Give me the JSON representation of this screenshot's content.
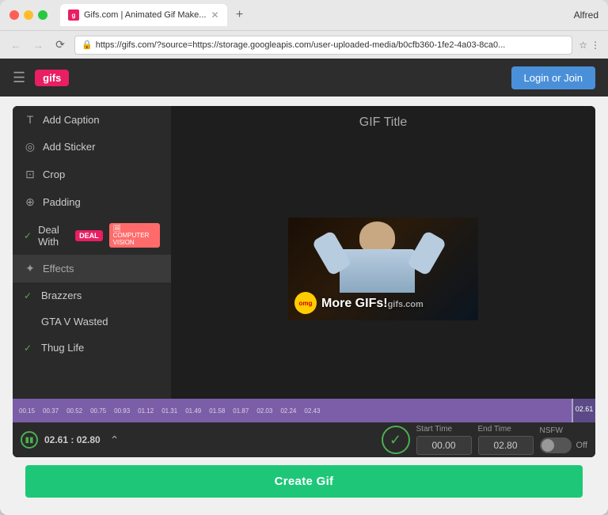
{
  "browser": {
    "tab_title": "Gifs.com | Animated Gif Make...",
    "url": "https://gifs.com/?source=https://storage.googleapis.com/user-uploaded-media/b0cfb360-1fe2-4a03-8ca0...",
    "user": "Alfred"
  },
  "header": {
    "logo": "gifs",
    "login_label": "Login or Join"
  },
  "gif_title": "GIF Title",
  "sidebar": {
    "items": [
      {
        "id": "add-caption",
        "icon": "T",
        "label": "Add Caption",
        "checked": false
      },
      {
        "id": "add-sticker",
        "icon": "◎",
        "label": "Add Sticker",
        "checked": false
      },
      {
        "id": "crop",
        "icon": "⊡",
        "label": "Crop",
        "checked": false
      },
      {
        "id": "padding",
        "icon": "⊕",
        "label": "Padding",
        "checked": false
      },
      {
        "id": "deal-with",
        "icon": "✓",
        "label": "Deal With",
        "checked": true,
        "badge": "COMPUTER VISION"
      },
      {
        "id": "effects",
        "icon": "✦",
        "label": "Effects",
        "checked": false
      },
      {
        "id": "brazzers",
        "icon": "",
        "label": "Brazzers",
        "checked": true
      },
      {
        "id": "gta-v-wasted",
        "icon": "",
        "label": "GTA V Wasted",
        "checked": false
      },
      {
        "id": "thug-life",
        "icon": "",
        "label": "Thug Life",
        "checked": true
      }
    ]
  },
  "timeline": {
    "ticks": [
      "00:15",
      "00:37",
      "00:52",
      "00:75",
      "00:93",
      "01:12",
      "01:31",
      "01:49",
      "01:58",
      "01:87",
      "02:03",
      "02:24",
      "02:43",
      "02:61"
    ]
  },
  "controls": {
    "time_display": "02.61 : 02.80",
    "start_time_label": "Start Time",
    "end_time_label": "End Time",
    "nsfw_label": "NSFW",
    "start_value": "00.00",
    "end_value": "02.80",
    "toggle_text": "Off"
  },
  "create_gif_label": "Create Gif"
}
